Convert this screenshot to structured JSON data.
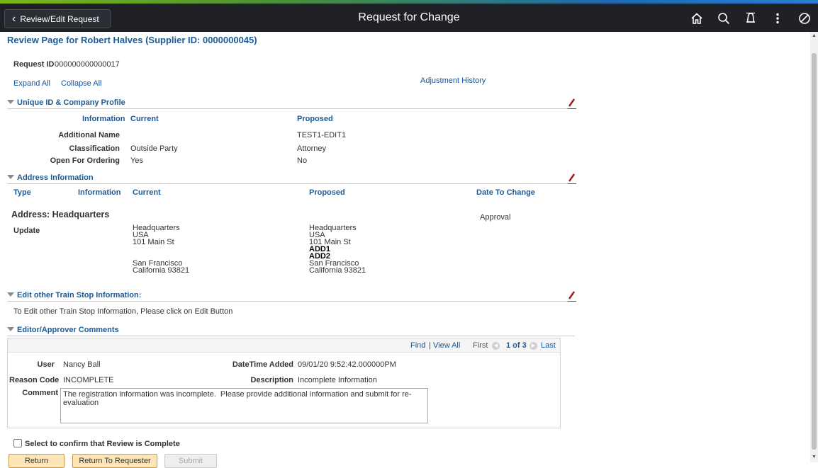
{
  "topbar": {
    "back_label": "Review/Edit Request",
    "title": "Request for Change",
    "icons": [
      "home-icon",
      "search-icon",
      "notification-icon",
      "actions-menu-icon",
      "navbar-icon"
    ]
  },
  "page": {
    "title": "Review Page for Robert Halves (Supplier ID: 0000000045)",
    "request_id_label": "Request ID",
    "request_id_value": "000000000000017",
    "expand_all": "Expand All",
    "collapse_all": "Collapse All",
    "adjustment_history": "Adjustment History"
  },
  "profile_section": {
    "title": "Unique ID & Company Profile",
    "headers": {
      "information": "Information",
      "current": "Current",
      "proposed": "Proposed"
    },
    "rows": [
      {
        "label": "Additional Name",
        "current": "",
        "proposed": "TEST1-EDIT1"
      },
      {
        "label": "Classification",
        "current": "Outside Party",
        "proposed": "Attorney"
      },
      {
        "label": "Open For Ordering",
        "current": "Yes",
        "proposed": "No"
      }
    ]
  },
  "address_section": {
    "title": "Address Information",
    "headers": {
      "type": "Type",
      "information": "Information",
      "current": "Current",
      "proposed": "Proposed",
      "date_to_change": "Date To Change"
    },
    "address_title": "Address: Headquarters",
    "date_value": "Approval",
    "type_value": "Update",
    "current_lines": [
      "Headquarters",
      "USA",
      "101 Main St",
      "",
      "",
      "San Francisco",
      "California   93821"
    ],
    "proposed_lines": [
      "Headquarters",
      "USA",
      "101 Main St",
      "ADD1",
      "ADD2",
      "San Francisco",
      "California   93821"
    ]
  },
  "train_section": {
    "title": "Edit other Train Stop Information:",
    "instruction": "To Edit other Train Stop Information, Please click on Edit Button"
  },
  "comments_section": {
    "title": "Editor/Approver Comments",
    "find": "Find",
    "separator": "|",
    "view_all": "View All",
    "first": "First",
    "position": "1 of 3",
    "last": "Last",
    "user_label": "User",
    "user_value": "Nancy Ball",
    "datetime_label": "DateTime Added",
    "datetime_value": "09/01/20  9:52:42.000000PM",
    "reason_label": "Reason Code",
    "reason_value": "INCOMPLETE",
    "description_label": "Description",
    "description_value": "Incomplete Information",
    "comment_label": "Comment",
    "comment_value": "The registration information was incomplete.  Please provide additional information and submit for re-evaluation"
  },
  "confirm": {
    "label": "Select to confirm that Review is Complete"
  },
  "buttons": {
    "return": "Return",
    "return_to_requester": "Return To Requester",
    "submit": "Submit"
  }
}
